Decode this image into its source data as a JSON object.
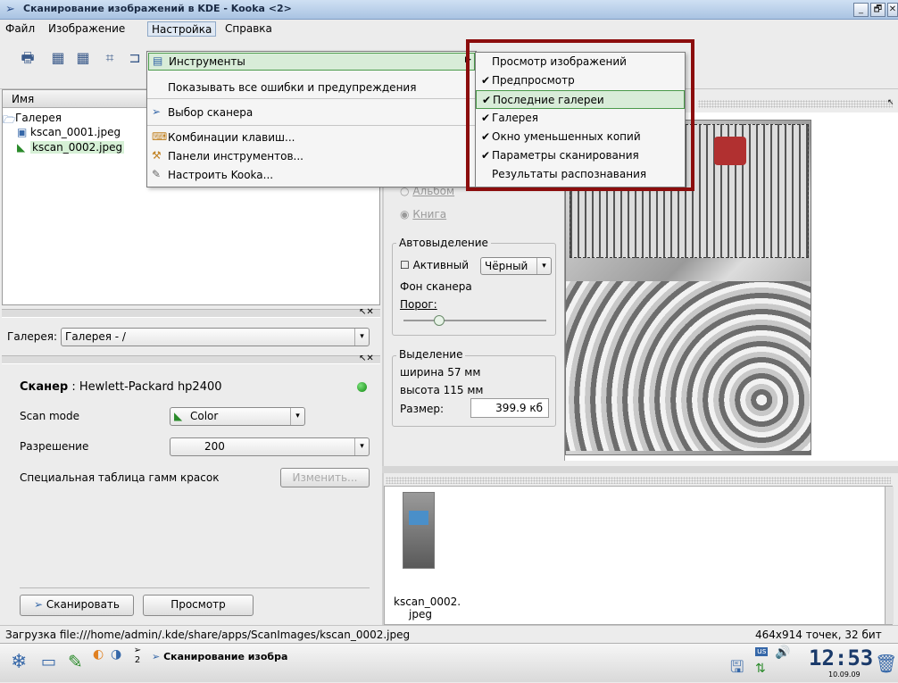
{
  "window": {
    "title": "Сканирование изображений в KDE - Kooka <2>"
  },
  "menubar": {
    "file": "Файл",
    "image": "Изображение",
    "settings": "Настройка",
    "help": "Справка"
  },
  "settings_menu": {
    "tools": "Инструменты",
    "show_errors": "Показывать все ошибки и предупреждения",
    "select_scanner": "Выбор сканера",
    "shortcuts": "Комбинации клавиш...",
    "toolbars": "Панели инструментов...",
    "configure": "Настроить Kooka..."
  },
  "tools_submenu": [
    {
      "label": "Просмотр изображений",
      "checked": ""
    },
    {
      "label": "Предпросмотр",
      "checked": "✔"
    },
    {
      "label": "Последние галереи",
      "checked": "✔"
    },
    {
      "label": "Галерея",
      "checked": "✔"
    },
    {
      "label": "Окно уменьшенных копий",
      "checked": "✔"
    },
    {
      "label": "Параметры сканирования",
      "checked": "✔"
    },
    {
      "label": "Результаты распознавания",
      "checked": ""
    }
  ],
  "tree": {
    "column": "Имя",
    "root": "Галерея",
    "items": [
      "kscan_0001.jpeg",
      "kscan_0002.jpeg"
    ]
  },
  "gallery_bar": {
    "label": "Галерея:",
    "value": "Галерея - /"
  },
  "scanner": {
    "label": "Сканер",
    "device": ": Hewlett-Packard hp2400",
    "scan_mode_label": "Scan mode",
    "scan_mode_value": "Color",
    "resolution_label": "Разрешение",
    "resolution_value": "200",
    "gamma_label": "Специальная таблица гамм красок",
    "change_button": "Изменить...",
    "scan_button": "Сканировать",
    "preview_button": "Просмотр"
  },
  "preview_opts": {
    "album": "Альбом",
    "book": "Книга",
    "autoselect_title": "Автовыделение",
    "active": "Активный",
    "color": "Чёрный",
    "bg": "Фон сканера",
    "threshold": "Порог:",
    "threshold_level": 0.25,
    "selection_title": "Выделение",
    "width": "ширина 57 мм",
    "height": "высота 115 мм",
    "size_label": "Размер:",
    "size_value": "399.9 кб"
  },
  "thumbnail": {
    "caption1": "kscan_0002.",
    "caption2": "jpeg"
  },
  "status": {
    "left": "Загрузка file:///home/admin/.kde/share/apps/ScanImages/kscan_0002.jpeg",
    "right": "464x914 точек, 32 бит"
  },
  "taskbar": {
    "task": "Сканирование изобра",
    "desktop": "2",
    "layout": "us",
    "clock": "12:53",
    "date": "10.09.09"
  }
}
